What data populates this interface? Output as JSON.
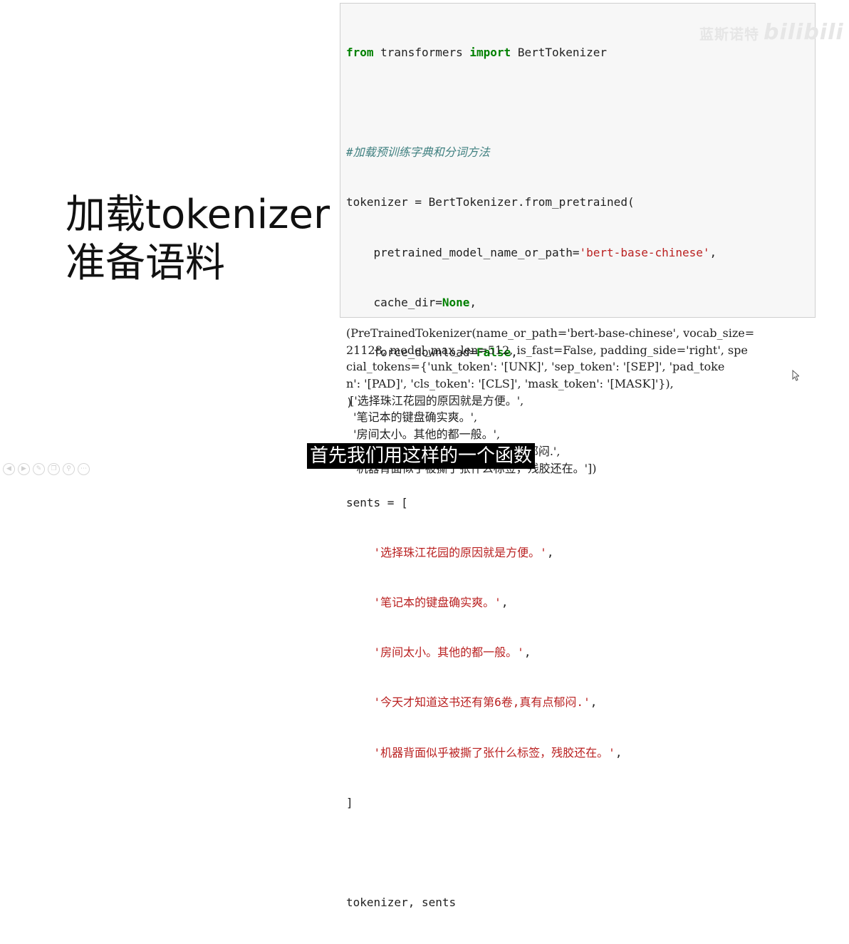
{
  "slide": {
    "title_line1": "加载tokenizer",
    "title_line2": "准备语料"
  },
  "code": {
    "l1_kw1": "from",
    "l1_mod": " transformers ",
    "l1_kw2": "import",
    "l1_cls": " BertTokenizer",
    "l3_comment": "#加载预训练字典和分词方法",
    "l4": "tokenizer = BertTokenizer.from_pretrained(",
    "l5_arg": "    pretrained_model_name_or_path=",
    "l5_str": "'bert-base-chinese'",
    "l5_end": ",",
    "l6_arg": "    cache_dir=",
    "l6_kw": "None",
    "l6_end": ",",
    "l7_arg": "    force_download=",
    "l7_kw": "False",
    "l7_end": ",",
    "l8": ")",
    "l10": "sents = [",
    "s1": "    '选择珠江花园的原因就是方便。'",
    "s2": "    '笔记本的键盘确实爽。'",
    "s3": "    '房间太小。其他的都一般。'",
    "s4": "    '今天才知道这书还有第6卷,真有点郁闷.'",
    "s5": "    '机器背面似乎被撕了张什么标签，残胶还在。'",
    "comma": ",",
    "l16": "]",
    "l18": "tokenizer, sents"
  },
  "output": {
    "lines": [
      "(PreTrainedTokenizer(name_or_path='bert-base-chinese', vocab_size=",
      "21128, model_max_len=512, is_fast=False, padding_side='right', spe",
      "cial_tokens={'unk_token': '[UNK]', 'sep_token': '[SEP]', 'pad_toke",
      "n': '[PAD]', 'cls_token': '[CLS]', 'mask_token': '[MASK]'}),",
      " ['选择珠江花园的原因就是方便。',",
      "  '笔记本的键盘确实爽。',",
      "  '房间太小。其他的都一般。',",
      "  '今天才知道这书还有第6卷,真有点郁闷.',",
      "  '机器背面似乎被撕了张什么标签，残胶还在。'])"
    ]
  },
  "subtitle": "首先我们用这样的一个函数",
  "watermark": {
    "text": "蓝斯诺特",
    "logo": "bilibili"
  },
  "colors": {
    "keyword": "#008000",
    "comment": "#408080",
    "string": "#ba2121",
    "cell_bg": "#f7f7f7"
  },
  "icons": [
    "prev-icon",
    "play-icon",
    "pen-icon",
    "copy-icon",
    "zoom-icon",
    "more-icon"
  ]
}
